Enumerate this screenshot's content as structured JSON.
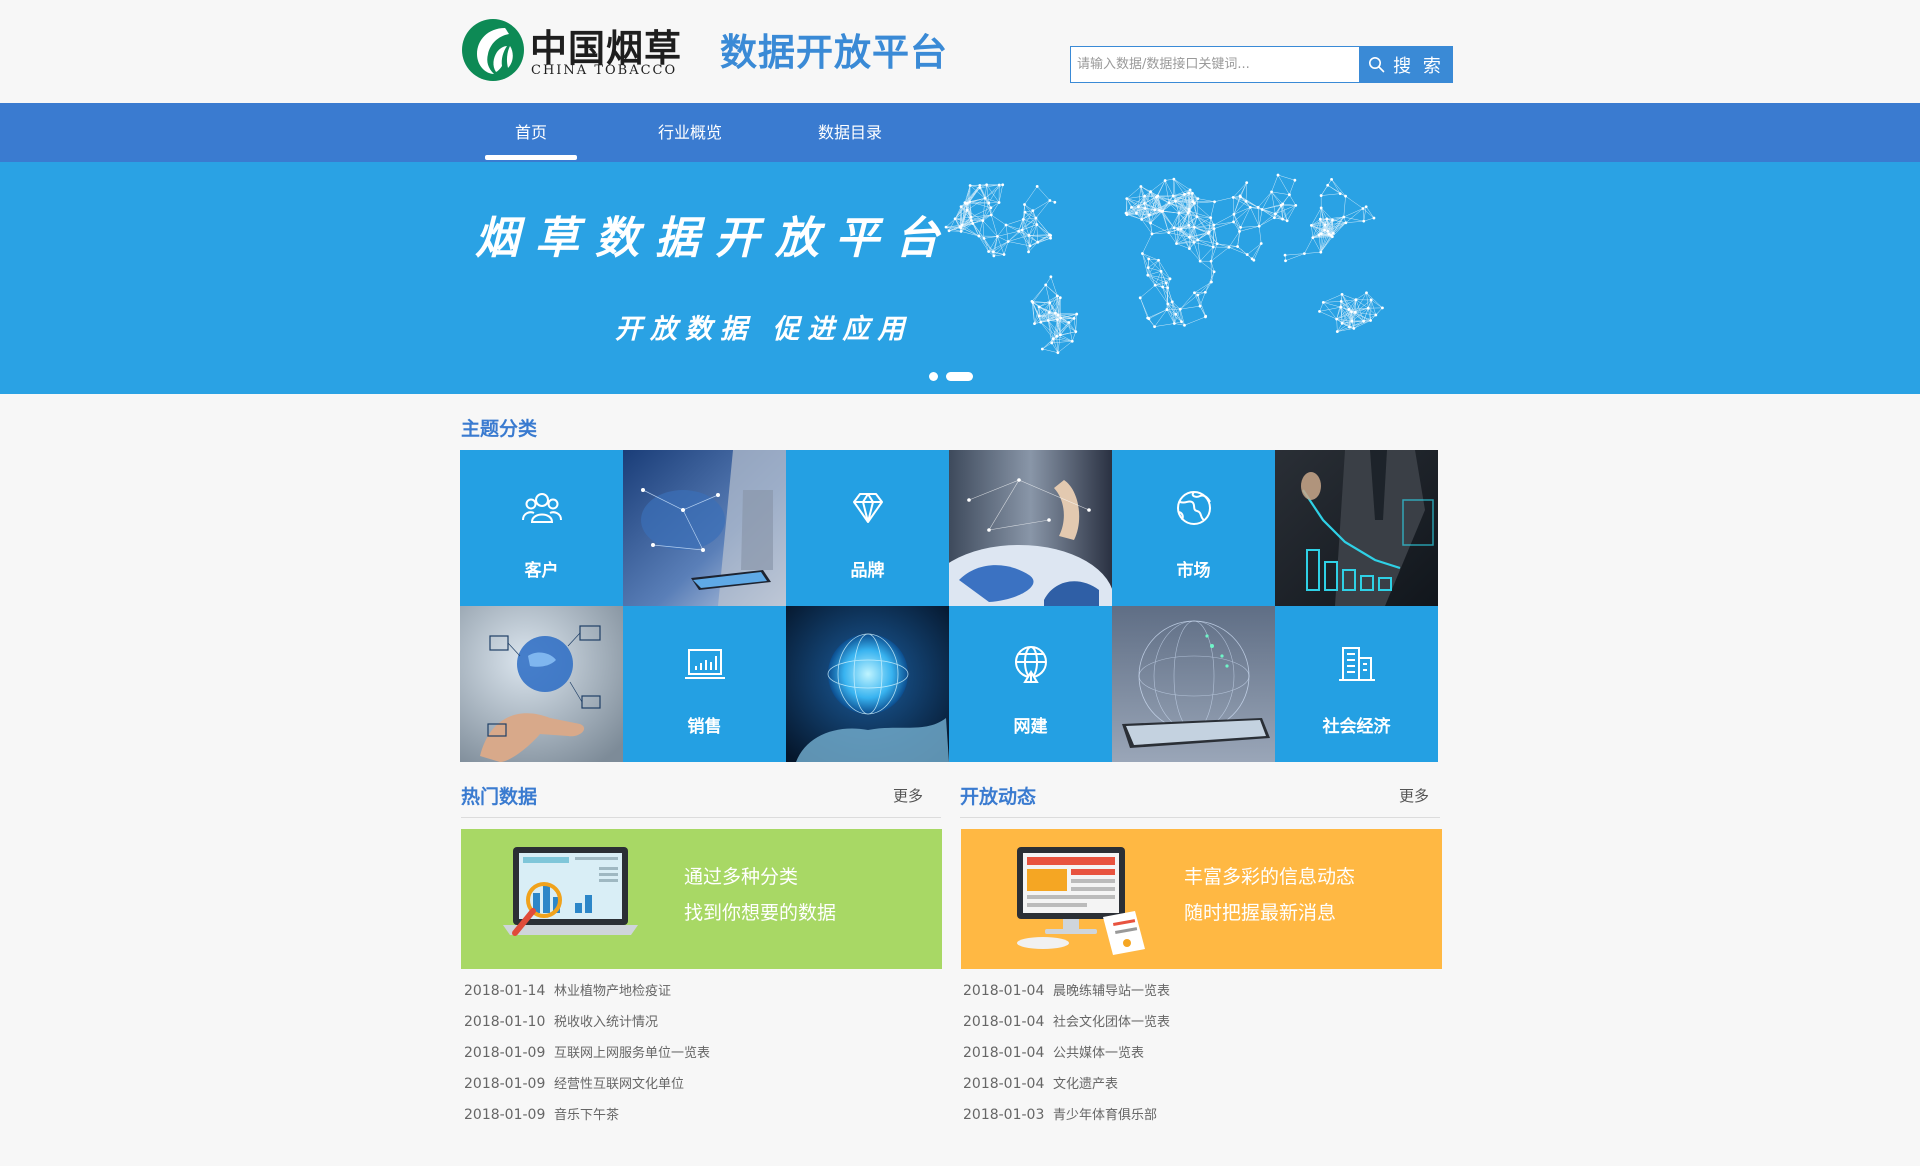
{
  "header": {
    "logo_cn": "中国烟草",
    "logo_en": "CHINA TOBACCO",
    "site_title": "数据开放平台",
    "search": {
      "placeholder": "请输入数据/数据接口关键词...",
      "button_label": "搜 索"
    }
  },
  "nav": {
    "items": [
      {
        "label": "首页",
        "active": true
      },
      {
        "label": "行业概览",
        "active": false
      },
      {
        "label": "数据目录",
        "active": false
      }
    ]
  },
  "banner": {
    "title": "烟草数据开放平台",
    "subtitle": "开放数据   促进应用",
    "slides_total": 2,
    "active_slide": 2
  },
  "topics": {
    "title": "主题分类",
    "items": [
      {
        "label": "客户",
        "icon": "users-icon"
      },
      {
        "label": "品牌",
        "icon": "diamond-icon"
      },
      {
        "label": "市场",
        "icon": "globe-icon"
      },
      {
        "label": "销售",
        "icon": "bar-chart-icon"
      },
      {
        "label": "网建",
        "icon": "network-globe-icon"
      },
      {
        "label": "社会经济",
        "icon": "building-icon"
      }
    ]
  },
  "hot_data": {
    "title": "热门数据",
    "more": "更多",
    "promo": {
      "line1": "通过多种分类",
      "line2": "找到你想要的数据",
      "color": "#a8d865"
    },
    "items": [
      {
        "date": "2018-01-14",
        "text": "林业植物产地检疫证"
      },
      {
        "date": "2018-01-10",
        "text": "税收收入统计情况"
      },
      {
        "date": "2018-01-09",
        "text": "互联网上网服务单位一览表"
      },
      {
        "date": "2018-01-09",
        "text": "经营性互联网文化单位"
      },
      {
        "date": "2018-01-09",
        "text": "音乐下午茶"
      }
    ]
  },
  "open_news": {
    "title": "开放动态",
    "more": "更多",
    "promo": {
      "line1": "丰富多彩的信息动态",
      "line2": "随时把握最新消息",
      "color": "#ffb843"
    },
    "items": [
      {
        "date": "2018-01-04",
        "text": "晨晚练辅导站一览表"
      },
      {
        "date": "2018-01-04",
        "text": "社会文化团体一览表"
      },
      {
        "date": "2018-01-04",
        "text": "公共媒体一览表"
      },
      {
        "date": "2018-01-04",
        "text": "文化遗产表"
      },
      {
        "date": "2018-01-03",
        "text": "青少年体育俱乐部"
      }
    ]
  },
  "colors": {
    "brand_blue": "#3a7bd0",
    "banner_blue": "#2aa2e4",
    "tile_blue": "#24a0e3",
    "logo_green": "#0d8a55"
  }
}
